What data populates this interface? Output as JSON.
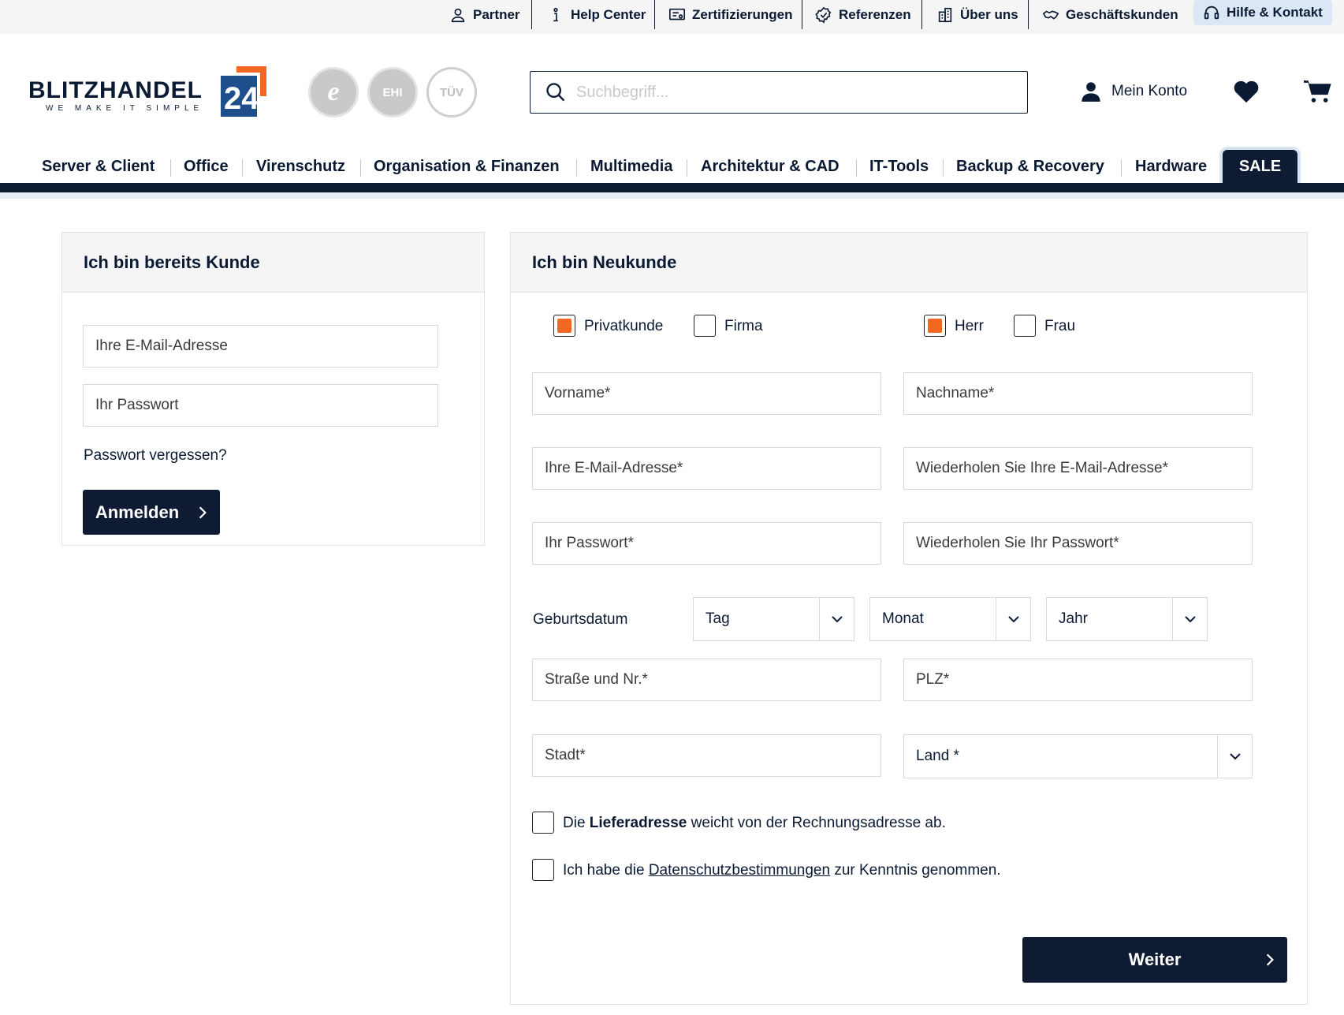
{
  "topbar": {
    "partner": "Partner",
    "help_center": "Help Center",
    "zertifizierungen": "Zertifizierungen",
    "referenzen": "Referenzen",
    "ueber_uns": "Über uns",
    "geschaeftskunden": "Geschäftskunden",
    "hilfe_kontakt": "Hilfe & Kontakt"
  },
  "header": {
    "logo_text": "BLITZHANDEL",
    "logo_number": "24",
    "logo_slogan": "WE MAKE IT SIMPLE",
    "search_placeholder": "Suchbegriff...",
    "account_label": "Mein Konto",
    "badges": [
      "e",
      "EHI",
      "TÜV"
    ]
  },
  "nav": {
    "items": [
      "Server & Client",
      "Office",
      "Virenschutz",
      "Organisation & Finanzen",
      "Multimedia",
      "Architektur & CAD",
      "IT-Tools",
      "Backup & Recovery",
      "Hardware"
    ],
    "sale": "SALE"
  },
  "login": {
    "title": "Ich bin bereits Kunde",
    "email_placeholder": "Ihre E-Mail-Adresse",
    "password_placeholder": "Ihr Passwort",
    "forgot": "Passwort vergessen?",
    "submit": "Anmelden"
  },
  "register": {
    "title": "Ich bin Neukunde",
    "customer_type": {
      "private": "Privatkunde",
      "company": "Firma",
      "selected": "Privatkunde"
    },
    "salutation": {
      "mr": "Herr",
      "mrs": "Frau",
      "selected": "Herr"
    },
    "firstname": "Vorname*",
    "lastname": "Nachname*",
    "email": "Ihre E-Mail-Adresse*",
    "email_repeat": "Wiederholen Sie Ihre E-Mail-Adresse*",
    "password": "Ihr Passwort*",
    "password_repeat": "Wiederholen Sie Ihr Passwort*",
    "birthdate_label": "Geburtsdatum",
    "day": "Tag",
    "month": "Monat",
    "year": "Jahr",
    "street": "Straße und Nr.*",
    "zip": "PLZ*",
    "city": "Stadt*",
    "country": "Land *",
    "delivery_pre": "Die ",
    "delivery_bold": "Lieferadresse",
    "delivery_post": " weicht von der Rechnungsadresse ab.",
    "privacy_pre": "Ich habe die ",
    "privacy_link": "Datenschutzbestimmungen",
    "privacy_post": " zur Kenntnis genommen.",
    "submit": "Weiter"
  },
  "colors": {
    "navy": "#0f1b33",
    "accent_orange": "#f26822",
    "logo_blue": "#1f4e8c"
  }
}
